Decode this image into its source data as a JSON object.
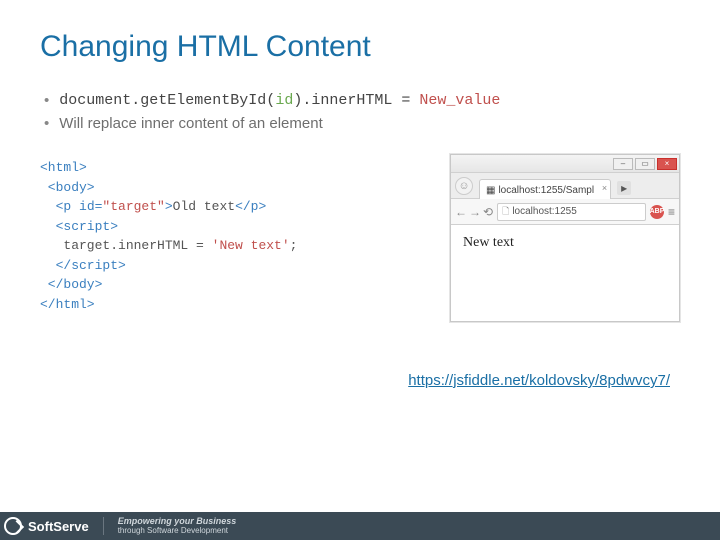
{
  "title": "Changing HTML Content",
  "bullets": {
    "b1_pre": "document.getElementById(",
    "b1_id": "id",
    "b1_mid": ").innerHTML = ",
    "b1_new": "New_value",
    "b2": "Will replace inner content of an element"
  },
  "code": {
    "l1": "<html>",
    "l2": " <body>",
    "l3_open": "  <p ",
    "l3_attr": "id=",
    "l3_val": "\"target\"",
    "l3_close": ">",
    "l3_text": "Old text",
    "l3_end": "</p>",
    "l4": "  <script>",
    "l5_pre": "   target.innerHTML = ",
    "l5_str": "'New text'",
    "l5_post": ";",
    "l6": "  </script>",
    "l7": " </body>",
    "l8": "</html>"
  },
  "browser": {
    "tab_label": "localhost:1255/Sampl",
    "url_text": "localhost:1255",
    "rendered": "New text",
    "ext_badge": "ABP"
  },
  "link": "https://jsfiddle.net/koldovsky/8pdwvcy7/",
  "footer": {
    "brand": "SoftServe",
    "tagline1": "Empowering your Business",
    "tagline2": "through Software Development"
  }
}
